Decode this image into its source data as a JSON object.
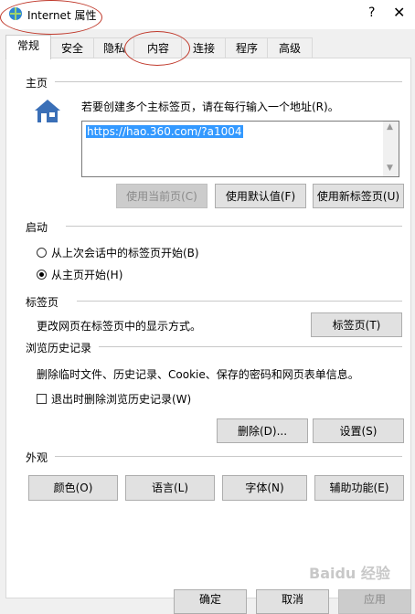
{
  "window": {
    "title": "Internet 属性",
    "help": "?",
    "close": "✕"
  },
  "tabs": [
    "常规",
    "安全",
    "隐私",
    "内容",
    "连接",
    "程序",
    "高级"
  ],
  "homepage": {
    "label": "主页",
    "instruction": "若要创建多个主标签页，请在每行输入一个地址(R)。",
    "url": "https://hao.360.com/?a1004",
    "btn_current": "使用当前页(C)",
    "btn_default": "使用默认值(F)",
    "btn_newtab": "使用新标签页(U)"
  },
  "startup": {
    "label": "启动",
    "option_last_session": "从上次会话中的标签页开始(B)",
    "option_home": "从主页开始(H)"
  },
  "tabs_section": {
    "label": "标签页",
    "description": "更改网页在标签页中的显示方式。",
    "btn_tabs": "标签页(T)"
  },
  "history": {
    "label": "浏览历史记录",
    "description": "删除临时文件、历史记录、Cookie、保存的密码和网页表单信息。",
    "checkbox_delete_on_exit": "退出时删除浏览历史记录(W)",
    "btn_delete": "删除(D)...",
    "btn_settings": "设置(S)"
  },
  "appearance": {
    "label": "外观",
    "btn_colors": "颜色(O)",
    "btn_languages": "语言(L)",
    "btn_fonts": "字体(N)",
    "btn_accessibility": "辅助功能(E)"
  },
  "footer": {
    "ok": "确定",
    "cancel": "取消",
    "apply": "应用"
  },
  "watermark": "Baidu 经验"
}
